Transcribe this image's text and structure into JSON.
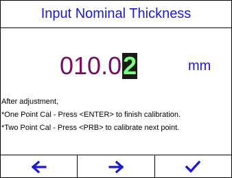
{
  "header": {
    "title": "Input Nominal Thickness"
  },
  "value": {
    "prefix": "010.0",
    "cursor_digit": "2",
    "unit": "mm"
  },
  "instructions": {
    "line1": "After adjustment,",
    "line2": "*One Point Cal - Press <ENTER> to finish calibration.",
    "line3": "*Two Point Cal - Press <PRB> to calibrate next point."
  },
  "footer": {
    "buttons": [
      {
        "icon": "arrow-left-icon"
      },
      {
        "icon": "arrow-right-icon"
      },
      {
        "icon": "checkmark-icon"
      }
    ]
  },
  "colors": {
    "title": "#1a1ad6",
    "value": "#7a0a62",
    "cursor_bg": "#1a1a1a",
    "cursor_fg": "#7cff7c",
    "icons": "#1a1ad6"
  }
}
